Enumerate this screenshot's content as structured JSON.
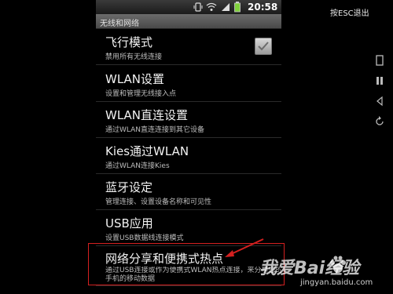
{
  "status": {
    "time": "20:58"
  },
  "header": {
    "title": "无线和网络"
  },
  "settings": [
    {
      "title": "飞行模式",
      "subtitle": "禁用所有无线连接"
    },
    {
      "title": "WLAN设置",
      "subtitle": "设置和管理无线接入点"
    },
    {
      "title": "WLAN直连设置",
      "subtitle": "通过WLAN直连连接到其它设备"
    },
    {
      "title": "Kies通过WLAN",
      "subtitle": "通过WLAN连接Kies"
    },
    {
      "title": "蓝牙设定",
      "subtitle": "管理连接、设置设备名称和可见性"
    },
    {
      "title": "USB应用",
      "subtitle": "设置USB数据线连接模式"
    },
    {
      "title": "网络分享和便携式热点",
      "subtitle": "通过USB连接或作为便携式WLAN热点连接，来分享您的手机的移动数据"
    }
  ],
  "emulator": {
    "esc_hint": "按ESC退出"
  },
  "watermark": {
    "text": "我爱Bai经验",
    "url": "jingyan.baidu.com"
  },
  "colors": {
    "highlight": "#d42020",
    "battery": "#7fd13b"
  }
}
